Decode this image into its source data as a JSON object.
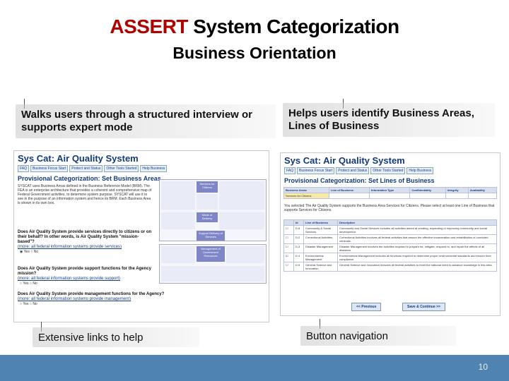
{
  "slide": {
    "title_accent": "ASSERT",
    "title_rest": " System Categorization",
    "subtitle": "Business Orientation",
    "page_number": "10"
  },
  "callouts": {
    "top_left": "Walks users through a structured interview or supports expert mode",
    "top_right": "Helps users identify Business Areas, Lines of Business",
    "bottom_left": "Extensive links to help",
    "bottom_right": "Button navigation"
  },
  "left_shot": {
    "app_title": "Sys Cat: Air Quality System",
    "tabs": [
      "FAQ",
      "Business Focus Start",
      "Protect and Status",
      "Other Tools Started",
      "Help Business"
    ],
    "heading": "Provisional Categorization: Set Business Areas",
    "paragraph": "SYSCAT uses Business Areas defined in the Business Reference Model (BRM). The FEA is an enterprise architecture that provides a coherent and comprehensive map of Federal Government activities, to determine system purpose. SYSCAT will use it to see in the purpose of an information system and hence its BRM. Each Business Area is shown in its own box.",
    "grid_labels": [
      "Services for Citizens",
      "Mode of Delivery",
      "Support Delivery of Services",
      "Management of Government Resources"
    ],
    "q1": "Does Air Quality System provide services directly to citizens or on their behalf? In other words, is Air Quality System \"mission-based\"?",
    "q1_link": "(more: all federal information systems provide services)",
    "q2": "Does Air Quality System provide support functions for the Agency mission?",
    "q2_link": "(more: all federal information systems provide support)",
    "q3": "Does Air Quality System provide management functions for the Agency?",
    "q3_link": "(more: all federal information systems provide management)",
    "yes": "Yes",
    "no": "No"
  },
  "right_shot": {
    "app_title": "Sys Cat: Air Quality System",
    "tabs": [
      "FAQ",
      "Business Focus Start",
      "Protect and Status",
      "Other Tools Started",
      "Help Business"
    ],
    "heading": "Provisional Categorization: Set Lines of Business",
    "columns": [
      "Business Areas",
      "Line of Business",
      "Information Type",
      "Confidentiality",
      "Integrity",
      "Availability"
    ],
    "selected_area": "Services for Citizens",
    "paragraph": "You selected The Air Quality System supports the Business Area Services for Citizens. Please select at least one Line of Business that supports Services for Citizens.",
    "table_head": [
      "Id",
      "Line of Business",
      "Description"
    ],
    "rows": [
      {
        "id": "D.8",
        "lob": "Community & Social Services",
        "desc": "Community and Social Services includes all activities aimed at creating, expanding or improving community and social development."
      },
      {
        "id": "D.2",
        "lob": "Correctional Activities",
        "desc": "Correctional Activities involves all federal activities that ensure the effective incarceration and rehabilitation of convicted criminals."
      },
      {
        "id": "D.3",
        "lob": "Disaster Management",
        "desc": "Disaster Management involves the activities required to prepare for, mitigate, respond to, and repair the effects of all disasters."
      },
      {
        "id": "D.4",
        "lob": "Environmental Management",
        "desc": "Environmental Management includes all functions required to determine proper environmental standards and ensure their compliance."
      },
      {
        "id": "D.5",
        "lob": "General Science and Innovation",
        "desc": "General Science and Innovation includes all federal activities to meet the national need to advance knowledge in this area."
      }
    ],
    "previous_button": "<< Previous",
    "save_button": "Save & Continue >>"
  }
}
